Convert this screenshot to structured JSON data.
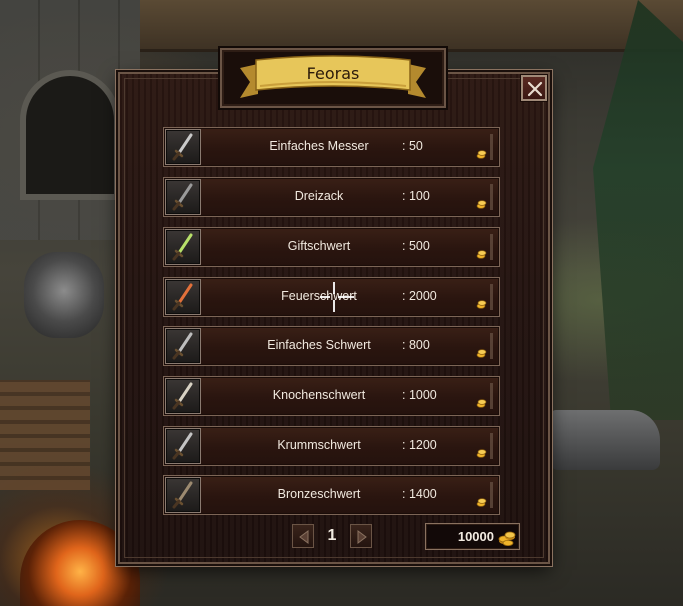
{
  "window": {
    "title": "Feoras",
    "close_label": "X"
  },
  "items": [
    {
      "name": "Einfaches Messer",
      "price": ": 50",
      "icon": "knife-icon",
      "blade_color": "#c9c9c9"
    },
    {
      "name": "Dreizack",
      "price": ": 100",
      "icon": "trident-icon",
      "blade_color": "#9a9a9a"
    },
    {
      "name": "Giftschwert",
      "price": ": 500",
      "icon": "poison-sword-icon",
      "blade_color": "#b7e06a"
    },
    {
      "name": "Feuerschwert",
      "price": ": 2000",
      "icon": "fire-sword-icon",
      "blade_color": "#e2703a"
    },
    {
      "name": "Einfaches Schwert",
      "price": ": 800",
      "icon": "sword-icon",
      "blade_color": "#bdbdbd"
    },
    {
      "name": "Knochenschwert",
      "price": ": 1000",
      "icon": "bone-sword-icon",
      "blade_color": "#d8d2c4"
    },
    {
      "name": "Krummschwert",
      "price": ": 1200",
      "icon": "scimitar-icon",
      "blade_color": "#c4c4c4"
    },
    {
      "name": "Bronzeschwert",
      "price": ": 1400",
      "icon": "bronze-sword-icon",
      "blade_color": "#9c8a70"
    }
  ],
  "pagination": {
    "page": "1"
  },
  "wallet": {
    "gold": "10000"
  },
  "colors": {
    "banner": "#e7c65a",
    "banner_shadow": "#a57a23",
    "coin": "#f0b42a"
  }
}
